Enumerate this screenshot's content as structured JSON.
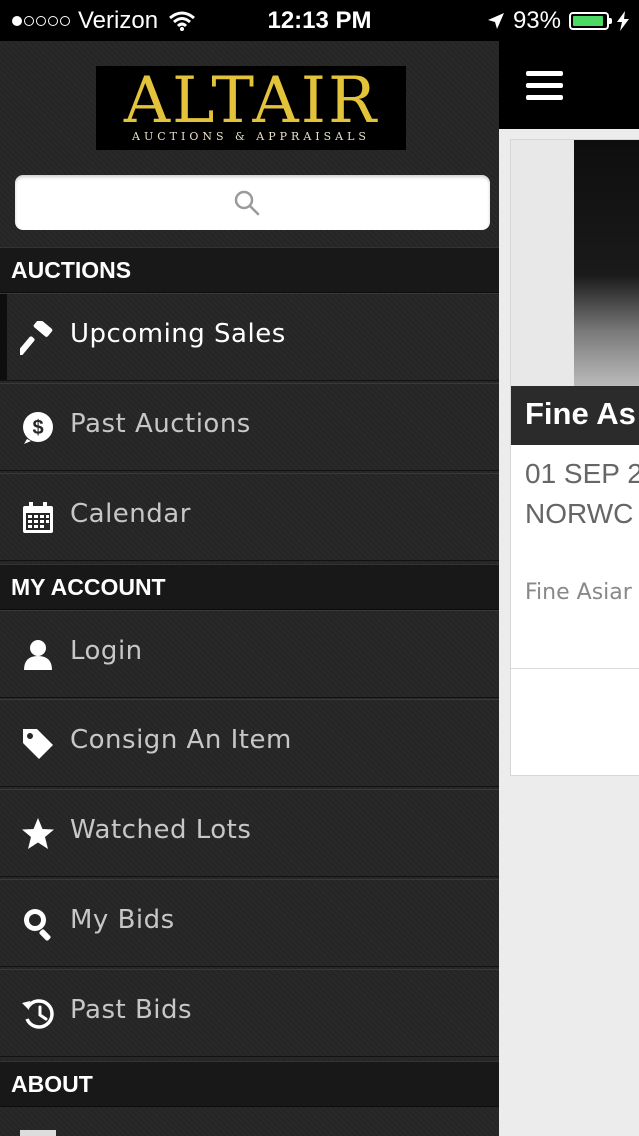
{
  "status_bar": {
    "carrier": "Verizon",
    "time": "12:13 PM",
    "battery": "93%",
    "battery_level": 0.93,
    "signal_bars": 1
  },
  "sidebar": {
    "logo": {
      "title": "ALTAIR",
      "subtitle": "AUCTIONS & APPRAISALS"
    },
    "sections": [
      {
        "label": "AUCTIONS"
      },
      {
        "label": "MY ACCOUNT"
      },
      {
        "label": "ABOUT"
      }
    ],
    "items": [
      {
        "label": "Upcoming Sales",
        "icon": "gavel-icon",
        "active": true
      },
      {
        "label": "Past Auctions",
        "icon": "dollar-icon"
      },
      {
        "label": "Calendar",
        "icon": "calendar-icon"
      },
      {
        "label": "Login",
        "icon": "user-icon"
      },
      {
        "label": "Consign An Item",
        "icon": "tag-icon"
      },
      {
        "label": "Watched Lots",
        "icon": "star-icon"
      },
      {
        "label": "My Bids",
        "icon": "search-bid-icon"
      },
      {
        "label": "Past Bids",
        "icon": "history-icon"
      }
    ]
  },
  "main": {
    "card": {
      "title": "Fine As",
      "date": "01 SEP 2",
      "location": "NORWC",
      "description": "Fine Asiar"
    }
  },
  "colors": {
    "sidebar_bg": "#262626",
    "section_bg": "#181818",
    "logo_gold": "#e3c33a",
    "battery_green": "#4cd964"
  }
}
